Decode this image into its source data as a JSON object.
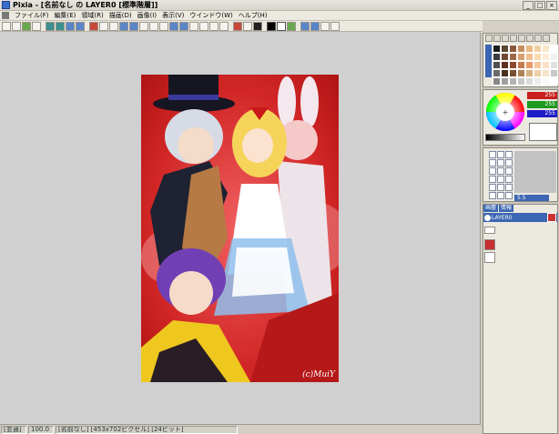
{
  "window": {
    "title": "Pixia - [名前なし の LAYER0 [標準階層]]"
  },
  "menu": {
    "items": [
      "ファイル(F)",
      "編集(E)",
      "領域(R)",
      "描画(D)",
      "画像(I)",
      "表示(V)",
      "ウインドウ(W)",
      "ヘルプ(H)"
    ]
  },
  "toolbar": {
    "icons": [
      "new-file-icon",
      "open-icon",
      "save-icon",
      "print-icon",
      "undo-icon",
      "redo-icon",
      "copy-icon",
      "paste-icon",
      "pen-icon",
      "eraser-icon",
      "rect-icon",
      "circle-icon",
      "line-icon",
      "curve-icon",
      "fill-icon",
      "text-icon",
      "zoom-icon",
      "color-black",
      "color-white"
    ]
  },
  "canvas": {
    "signature": "(c)MuiY"
  },
  "status": {
    "mode": "[並通]",
    "zoom": "100.0",
    "info": "[名前なし] [453x702ピクセル] [24ビット]"
  },
  "color_panel": {
    "r": "255",
    "g": "255",
    "b": "255"
  },
  "brush_panel": {
    "size": "5.5"
  },
  "layer_panel": {
    "tab_1": "画層",
    "tab_2": "情報",
    "layer_name": "LAYER0"
  },
  "palette": [
    "#1c1c1c",
    "#5a4632",
    "#8b5a3c",
    "#c89060",
    "#e8b880",
    "#f0d0a0",
    "#f8e8c8",
    "#ffffff",
    "#3c3c3c",
    "#704830",
    "#a06848",
    "#d8a070",
    "#f0c090",
    "#f8dcb0",
    "#fcecd8",
    "#f0f0f0",
    "#505050",
    "#603020",
    "#904830",
    "#c87850",
    "#e89868",
    "#f8c8a0",
    "#fce0c8",
    "#e0e0e0",
    "#6a6a6a",
    "#4a3020",
    "#7a5030",
    "#b08058",
    "#d8b080",
    "#f0d0a8",
    "#f8e4c8",
    "#c8c8c8",
    "#888888",
    "#a0a0a0",
    "#b4b4b4",
    "#c8c8c8",
    "#dcdcdc",
    "#ececec",
    "#f8f8f8",
    "#ffffff"
  ]
}
